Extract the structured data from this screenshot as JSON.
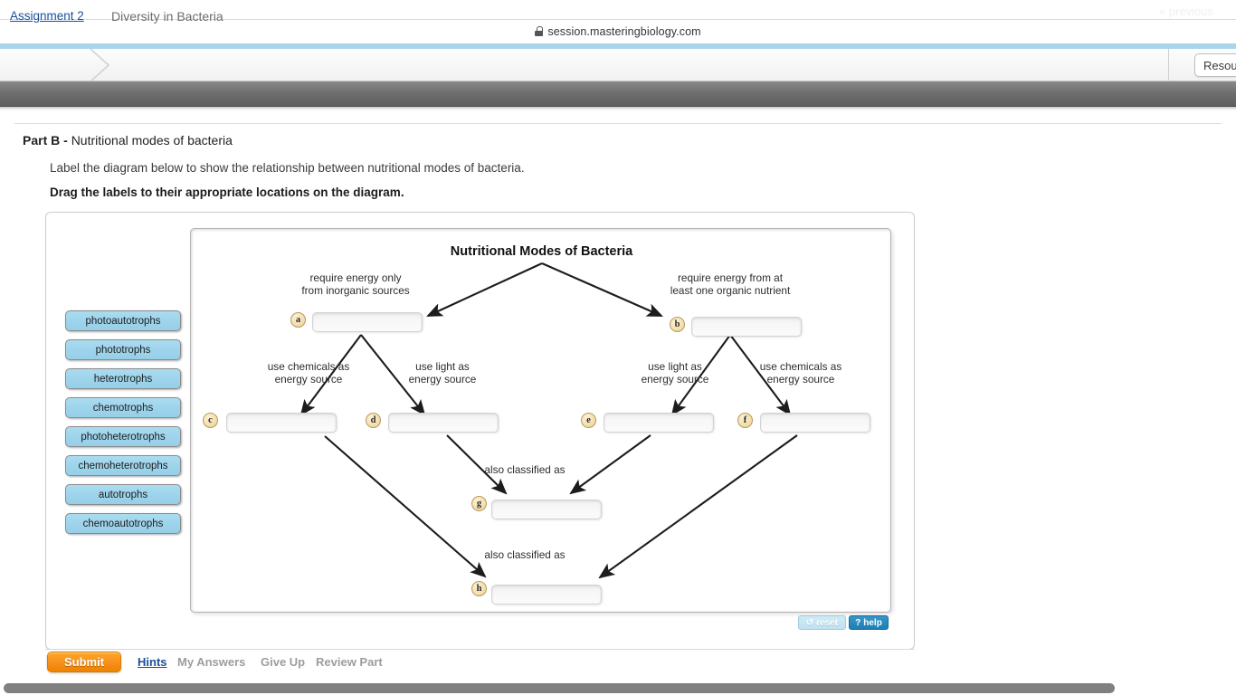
{
  "browser": {
    "url": "session.masteringbiology.com",
    "lock_icon": "lock-icon"
  },
  "breadcrumb": {
    "parent": "Assignment 2",
    "current": "Diversity in Bacteria",
    "resources_label": "Resources"
  },
  "nav": {
    "previous_label": "« previous"
  },
  "question": {
    "part_prefix": "Part B - ",
    "part_title": "Nutritional modes of bacteria",
    "prompt": "Label the diagram below to show the relationship between nutritional modes of bacteria.",
    "instruction": "Drag the labels to their appropriate locations on the diagram."
  },
  "label_bank": {
    "items": [
      {
        "text": "photoautotrophs"
      },
      {
        "text": "phototrophs"
      },
      {
        "text": "heterotrophs"
      },
      {
        "text": "chemotrophs"
      },
      {
        "text": "photoheterotrophs"
      },
      {
        "text": "chemoheterotrophs"
      },
      {
        "text": "autotrophs"
      },
      {
        "text": "chemoautotrophs"
      }
    ]
  },
  "diagram": {
    "title": "Nutritional Modes of Bacteria",
    "annotations": [
      {
        "key": "left_branch",
        "text": "require energy only\nfrom inorganic sources"
      },
      {
        "key": "right_branch",
        "text": "require energy from at\nleast one organic nutrient"
      },
      {
        "key": "c_branch",
        "text": "use chemicals as\nenergy source"
      },
      {
        "key": "d_branch",
        "text": "use light as\nenergy source"
      },
      {
        "key": "e_branch",
        "text": "use light as\nenergy source"
      },
      {
        "key": "f_branch",
        "text": "use chemicals as\nenergy source"
      },
      {
        "key": "g_branch",
        "text": "also classified as"
      },
      {
        "key": "h_branch",
        "text": "also classified as"
      }
    ],
    "drop_zones": [
      {
        "badge": "a",
        "value": ""
      },
      {
        "badge": "b",
        "value": ""
      },
      {
        "badge": "c",
        "value": ""
      },
      {
        "badge": "d",
        "value": ""
      },
      {
        "badge": "e",
        "value": ""
      },
      {
        "badge": "f",
        "value": ""
      },
      {
        "badge": "g",
        "value": ""
      },
      {
        "badge": "h",
        "value": ""
      }
    ],
    "reset_label": "reset",
    "reset_icon": "↺",
    "help_label": "help",
    "help_icon": "?"
  },
  "footer": {
    "submit_label": "Submit",
    "hints_label": "Hints",
    "my_answers_label": "My Answers",
    "give_up_label": "Give Up",
    "review_part_label": "Review Part"
  },
  "colors": {
    "accent_orange": "#f7931e",
    "link_blue": "#1a4f9c",
    "label_blue": "#9ed4ec",
    "strip_blue": "#a9d4ea",
    "nav_gray": "#6f6f6f"
  }
}
